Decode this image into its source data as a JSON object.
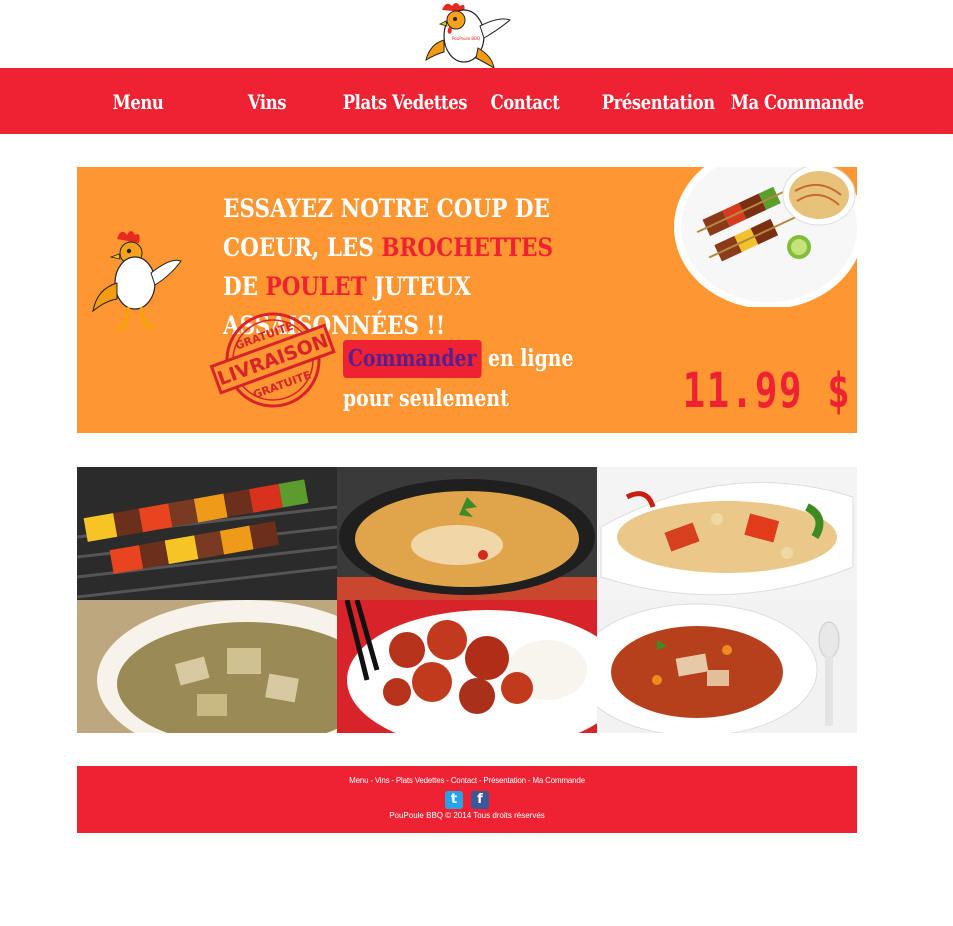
{
  "nav": {
    "items": [
      {
        "label": "Menu"
      },
      {
        "label": "Vins"
      },
      {
        "label": "Plats  Vedettes"
      },
      {
        "label": "Contact"
      },
      {
        "label": "Présentation"
      },
      {
        "label": "Ma  Commande"
      }
    ]
  },
  "logo": {
    "badge_text": "PouPoule BBQ"
  },
  "banner": {
    "headline_1": "Essayez notre coup de coeur, les",
    "headline_hl_1": "brochettes",
    "headline_2": " de ",
    "headline_hl_2": "poulet",
    "headline_3": " juteux assaisonnées !!",
    "stamp_top": "GRATUITE",
    "stamp_middle": "LIVRAISON",
    "stamp_bottom": "GRATUITE",
    "cta_button": "Commander",
    "cta_text": " en ligne pour seulement",
    "price": "11.99 $"
  },
  "gallery": {
    "tiles": [
      {
        "name": "brochettes-grill"
      },
      {
        "name": "curry-soup"
      },
      {
        "name": "cashew-chicken"
      },
      {
        "name": "curry-chicken-bowl"
      },
      {
        "name": "sesame-chicken-rice"
      },
      {
        "name": "tomato-chicken-soup"
      }
    ]
  },
  "footer": {
    "links": [
      "Menu",
      "Vins",
      "Plats Vedettes",
      "Contact",
      "Présentation",
      "Ma Commande"
    ],
    "separator": "-",
    "twitter_icon": "t",
    "facebook_icon": "f",
    "copyright": "PouPoule BBQ © 2014 Tous droits réservés"
  },
  "colors": {
    "brand_red": "#ee2233",
    "banner_orange": "#fe9632",
    "cta_text_purple": "#5a1f8f"
  }
}
